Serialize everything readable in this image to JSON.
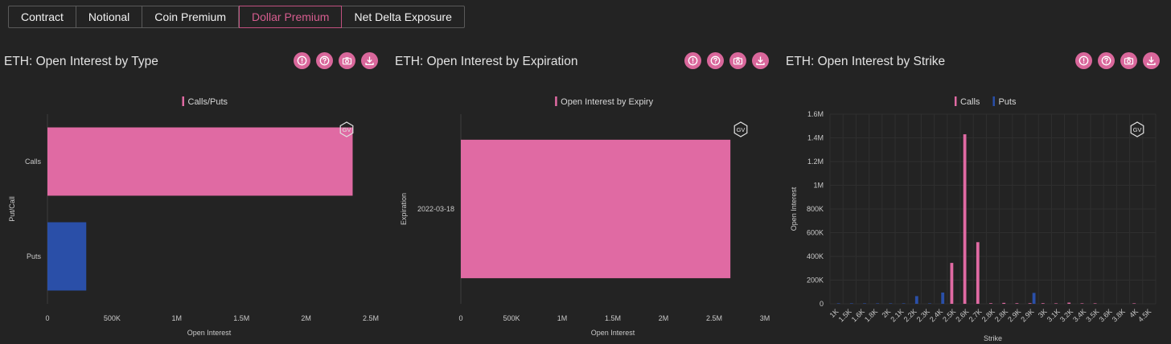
{
  "tabs": [
    {
      "label": "Contract",
      "active": false
    },
    {
      "label": "Notional",
      "active": false
    },
    {
      "label": "Coin Premium",
      "active": false
    },
    {
      "label": "Dollar Premium",
      "active": true
    },
    {
      "label": "Net Delta Exposure",
      "active": false
    }
  ],
  "icons": {
    "actions": [
      "info-icon",
      "help-icon",
      "camera-icon",
      "download-icon"
    ],
    "watermark": "gv-logo"
  },
  "colors": {
    "calls": "#e06aa3",
    "puts": "#2a4fa8",
    "accent": "#d9679b",
    "background": "#232323"
  },
  "watermark_text": "GV",
  "panels": [
    {
      "title": "ETH: Open Interest by Type",
      "chart_data": {
        "type": "bar",
        "orientation": "horizontal",
        "categories": [
          "Calls",
          "Puts"
        ],
        "series": [
          {
            "name": "Calls/Puts",
            "values": [
              2360000,
              300000
            ]
          }
        ],
        "bar_colors": [
          "#e06aa3",
          "#2a4fa8"
        ],
        "xlabel": "Open Interest",
        "ylabel": "Put/Call",
        "xlim": [
          0,
          2500000
        ],
        "xticks": [
          "0",
          "500K",
          "1M",
          "1.5M",
          "2M",
          "2.5M"
        ],
        "legend": [
          "Calls/Puts"
        ],
        "legend_position": "top-center",
        "grid": false
      }
    },
    {
      "title": "ETH: Open Interest by Expiration",
      "chart_data": {
        "type": "bar",
        "orientation": "horizontal",
        "categories": [
          "2022-03-18"
        ],
        "series": [
          {
            "name": "Open Interest by Expiry",
            "values": [
              2660000
            ]
          }
        ],
        "bar_colors": [
          "#e06aa3"
        ],
        "xlabel": "Open Interest",
        "ylabel": "Expiration",
        "xlim": [
          0,
          3000000
        ],
        "xticks": [
          "0",
          "500K",
          "1M",
          "1.5M",
          "2M",
          "2.5M",
          "3M"
        ],
        "legend": [
          "Open Interest by Expiry"
        ],
        "legend_position": "top-center",
        "grid": false
      }
    },
    {
      "title": "ETH: Open Interest by Strike",
      "chart_data": {
        "type": "bar",
        "orientation": "vertical",
        "categories": [
          "1K",
          "1.5K",
          "1.6K",
          "1.8K",
          "2K",
          "2.1K",
          "2.2K",
          "2.3K",
          "2.4K",
          "2.5K",
          "2.6K",
          "2.7K",
          "2.8K",
          "2.8K",
          "2.9K",
          "2.9K",
          "3K",
          "3.1K",
          "3.2K",
          "3.4K",
          "3.5K",
          "3.6K",
          "3.8K",
          "4K",
          "4.5K"
        ],
        "series": [
          {
            "name": "Calls",
            "values": [
              0,
              0,
              0,
              0,
              0,
              0,
              0,
              0,
              0,
              345000,
              1430000,
              520000,
              5000,
              8000,
              5000,
              5000,
              5000,
              4000,
              10000,
              4000,
              4000,
              0,
              0,
              4000,
              0
            ]
          },
          {
            "name": "Puts",
            "values": [
              4000,
              4000,
              4000,
              4000,
              4000,
              4000,
              65000,
              4000,
              95000,
              0,
              0,
              0,
              0,
              0,
              0,
              92000,
              0,
              0,
              0,
              0,
              0,
              0,
              0,
              0,
              0
            ]
          }
        ],
        "xlabel": "Strike",
        "ylabel": "Open Interest",
        "ylim": [
          0,
          1600000
        ],
        "yticks": [
          "0",
          "200K",
          "400K",
          "600K",
          "800K",
          "1M",
          "1.2M",
          "1.4M",
          "1.6M"
        ],
        "legend": [
          "Calls",
          "Puts"
        ],
        "legend_position": "top-center",
        "grid": true
      }
    }
  ]
}
